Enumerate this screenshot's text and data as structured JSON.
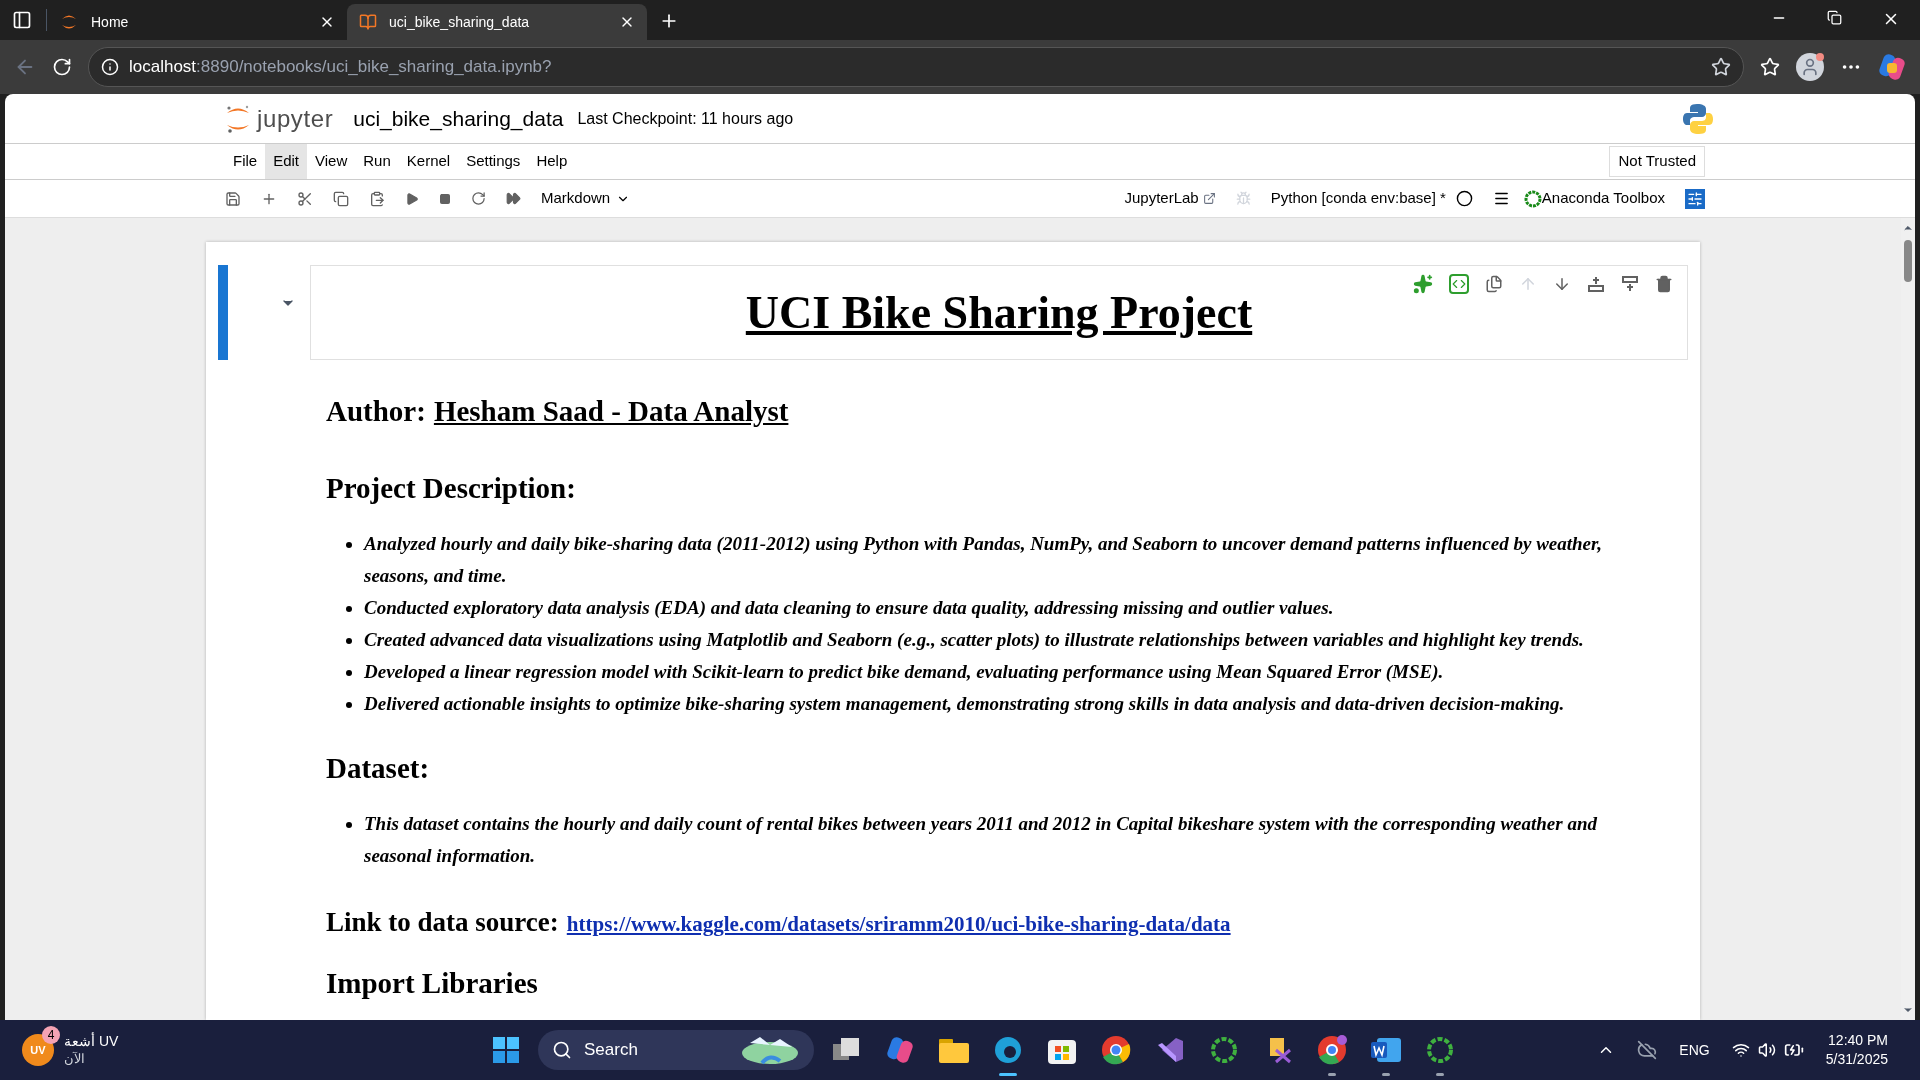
{
  "browser": {
    "tabs": [
      {
        "title": "Home",
        "selected": false
      },
      {
        "title": "uci_bike_sharing_data",
        "selected": true
      }
    ],
    "url": {
      "host": "localhost",
      "path": ":8890/notebooks/uci_bike_sharing_data.ipynb?"
    }
  },
  "jupyter": {
    "logo_text": "jupyter",
    "notebook_name": "uci_bike_sharing_data",
    "checkpoint": "Last Checkpoint: 11 hours ago",
    "menu": [
      {
        "label": "File",
        "selected": false
      },
      {
        "label": "Edit",
        "selected": true
      },
      {
        "label": "View",
        "selected": false
      },
      {
        "label": "Run",
        "selected": false
      },
      {
        "label": "Kernel",
        "selected": false
      },
      {
        "label": "Settings",
        "selected": false
      },
      {
        "label": "Help",
        "selected": false
      }
    ],
    "trust": "Not Trusted",
    "cell_type": "Markdown",
    "lab_link": "JupyterLab",
    "kernel": "Python [conda env:base] *",
    "toolbox": "Anaconda Toolbox"
  },
  "cell": {
    "title": "UCI Bike Sharing Project",
    "sections": [
      {
        "kind": "author",
        "label": "Author:",
        "name": "Hesham Saad - Data Analyst"
      },
      {
        "kind": "heading",
        "text": "Project Description:"
      },
      {
        "kind": "bullets",
        "items": [
          "Analyzed hourly and daily bike-sharing data (2011-2012) using Python with Pandas, NumPy, and Seaborn to uncover demand patterns influenced by weather, seasons, and time.",
          "Conducted exploratory data analysis (EDA) and data cleaning to ensure data quality, addressing missing and outlier values.",
          "Created advanced data visualizations using Matplotlib and Seaborn (e.g., scatter plots) to illustrate relationships between variables and highlight key trends.",
          "Developed a linear regression model with Scikit-learn to predict bike demand, evaluating performance using Mean Squared Error (MSE).",
          "Delivered actionable insights to optimize bike-sharing system management, demonstrating strong skills in data analysis and data-driven decision-making."
        ]
      },
      {
        "kind": "heading",
        "text": "Dataset:"
      },
      {
        "kind": "bullets",
        "items": [
          "This dataset contains the hourly and daily count of rental bikes between years 2011 and 2012 in Capital bikeshare system with the corresponding weather and seasonal information."
        ]
      },
      {
        "kind": "link",
        "label": "Link to data source:",
        "url": "https://www.kaggle.com/datasets/sriramm2010/uci-bike-sharing-data/data"
      },
      {
        "kind": "heading",
        "text": "Import Libraries"
      }
    ]
  },
  "taskbar": {
    "notification": {
      "avatar": "UV",
      "badge": "4",
      "title": "أشعة UV",
      "subtitle": "الآن"
    },
    "search": "Search",
    "language": "ENG",
    "time": "12:40 PM",
    "date": "5/31/2025"
  }
}
